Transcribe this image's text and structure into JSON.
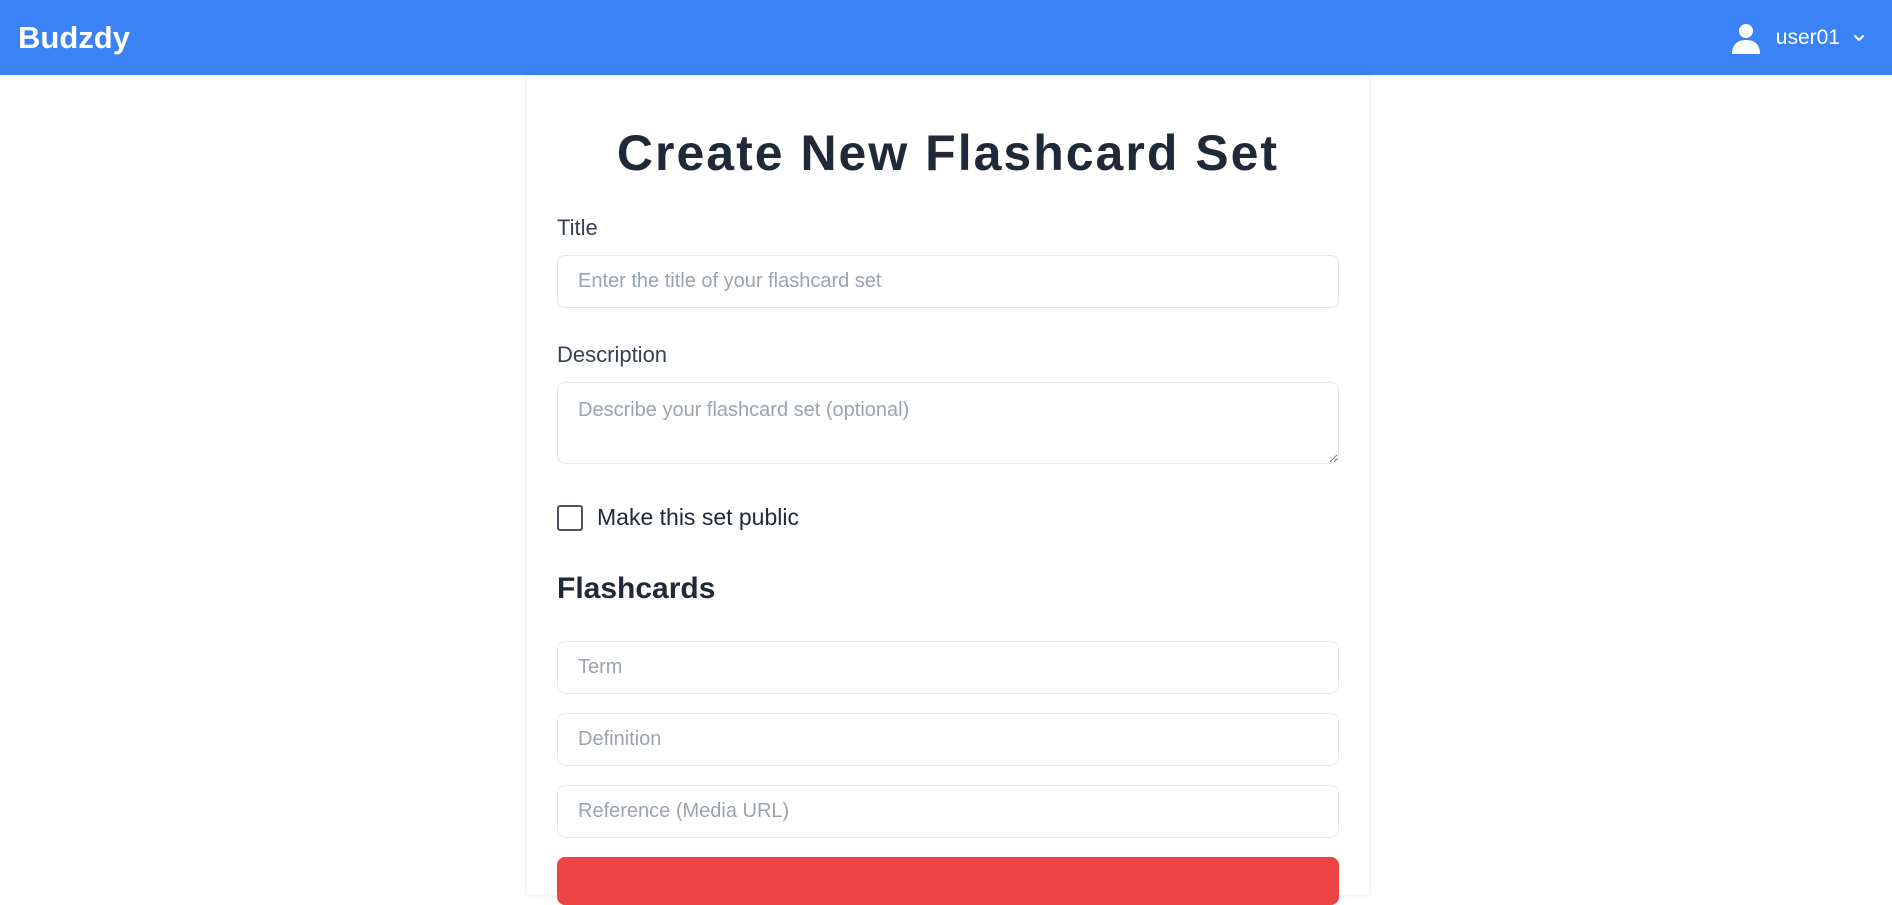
{
  "navbar": {
    "brand": "Budzdy",
    "username": "user01",
    "avatar_icon": "user-icon",
    "menu_icon": "chevron-down-icon",
    "background_color": "#3b82f6"
  },
  "form": {
    "heading": "Create New Flashcard Set",
    "title_label": "Title",
    "title_placeholder": "Enter the title of your flashcard set",
    "title_value": "",
    "description_label": "Description",
    "description_placeholder": "Describe your flashcard set (optional)",
    "description_value": "",
    "public_label": "Make this set public",
    "public_checked": false
  },
  "flashcards": {
    "heading": "Flashcards",
    "cards": [
      {
        "term_placeholder": "Term",
        "definition_placeholder": "Definition",
        "reference_placeholder": "Reference (Media URL)",
        "action_color": "#ef4444"
      }
    ]
  }
}
